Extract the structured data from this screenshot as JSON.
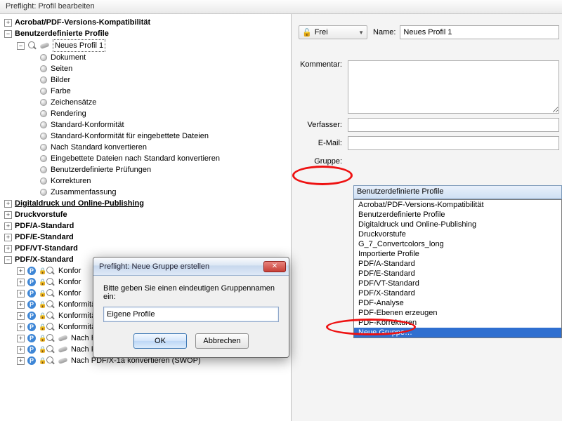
{
  "window": {
    "title": "Preflight: Profil bearbeiten"
  },
  "tree": {
    "groups": [
      {
        "label": "Acrobat/PDF-Versions-Kompatibilität",
        "exp": "+",
        "bold": true
      },
      {
        "label": "Benutzerdefinierte Profile",
        "exp": "−",
        "bold": true,
        "children": [
          {
            "label": "Neues Profil 1",
            "exp": "−",
            "icon": "mag+wrench",
            "selected": true,
            "children": [
              {
                "label": "Dokument"
              },
              {
                "label": "Seiten"
              },
              {
                "label": "Bilder"
              },
              {
                "label": "Farbe"
              },
              {
                "label": "Zeichensätze"
              },
              {
                "label": "Rendering"
              },
              {
                "label": "Standard-Konformität"
              },
              {
                "label": "Standard-Konformität für eingebettete Dateien"
              },
              {
                "label": "Nach Standard konvertieren"
              },
              {
                "label": "Eingebettete Dateien nach Standard konvertieren"
              },
              {
                "label": "Benutzerdefinierte Prüfungen"
              },
              {
                "label": "Korrekturen"
              },
              {
                "label": "Zusammenfassung"
              }
            ]
          }
        ]
      },
      {
        "label": "Digitaldruck und Online-Publishing",
        "exp": "+",
        "bold": true,
        "underline": true
      },
      {
        "label": "Druckvorstufe",
        "exp": "+",
        "bold": true
      },
      {
        "label": "PDF/A-Standard",
        "exp": "+",
        "bold": true
      },
      {
        "label": "PDF/E-Standard",
        "exp": "+",
        "bold": true
      },
      {
        "label": "PDF/VT-Standard",
        "exp": "+",
        "bold": true
      },
      {
        "label": "PDF/X-Standard",
        "exp": "−",
        "bold": true,
        "children": [
          {
            "label": "Konfor",
            "icon": "p-lock-mag",
            "exp": "+"
          },
          {
            "label": "Konfor",
            "icon": "p-lock-mag",
            "exp": "+"
          },
          {
            "label": "Konfor",
            "icon": "p-lock-mag",
            "exp": "+"
          },
          {
            "label": "Konformität mit PDF/X-4p prüfen",
            "icon": "p-lock-mag",
            "exp": "+"
          },
          {
            "label": "Konformität mit PDF/X-5g prüfen",
            "icon": "p-lock-mag",
            "exp": "+"
          },
          {
            "label": "Konformität mit PDF/X-5pg prüfen",
            "icon": "p-lock-mag",
            "exp": "+"
          },
          {
            "label": "Nach PDF/X-1a konvertieren (Coated FOGRA39)",
            "icon": "p-lock-mag-wrench",
            "exp": "+"
          },
          {
            "label": "Nach PDF/X-1a konvertieren (Japan Color Coated)",
            "icon": "p-lock-mag-wrench",
            "exp": "+"
          },
          {
            "label": "Nach PDF/X-1a konvertieren (SWOP)",
            "icon": "p-lock-mag-wrench",
            "exp": "+"
          }
        ]
      }
    ]
  },
  "right": {
    "lock_label": "Frei",
    "name_lbl": "Name:",
    "name_value": "Neues Profil 1",
    "comment_lbl": "Kommentar:",
    "author_lbl": "Verfasser:",
    "email_lbl": "E-Mail:",
    "group_lbl": "Gruppe:",
    "group_selected": "Benutzerdefinierte Profile",
    "group_options": [
      "Acrobat/PDF-Versions-Kompatibilität",
      "Benutzerdefinierte Profile",
      "Digitaldruck und Online-Publishing",
      "Druckvorstufe",
      "G_7_Convertcolors_long",
      "Importierte Profile",
      "PDF/A-Standard",
      "PDF/E-Standard",
      "PDF/VT-Standard",
      "PDF/X-Standard",
      "PDF-Analyse",
      "PDF-Ebenen erzeugen",
      "PDF-Korrekturen",
      "Neue Gruppe…"
    ],
    "group_highlight_index": 13
  },
  "dialog": {
    "title": "Preflight: Neue Gruppe erstellen",
    "prompt": "Bitte geben Sie einen eindeutigen Gruppennamen ein:",
    "value": "Eigene Profile",
    "ok": "OK",
    "cancel": "Abbrechen"
  }
}
